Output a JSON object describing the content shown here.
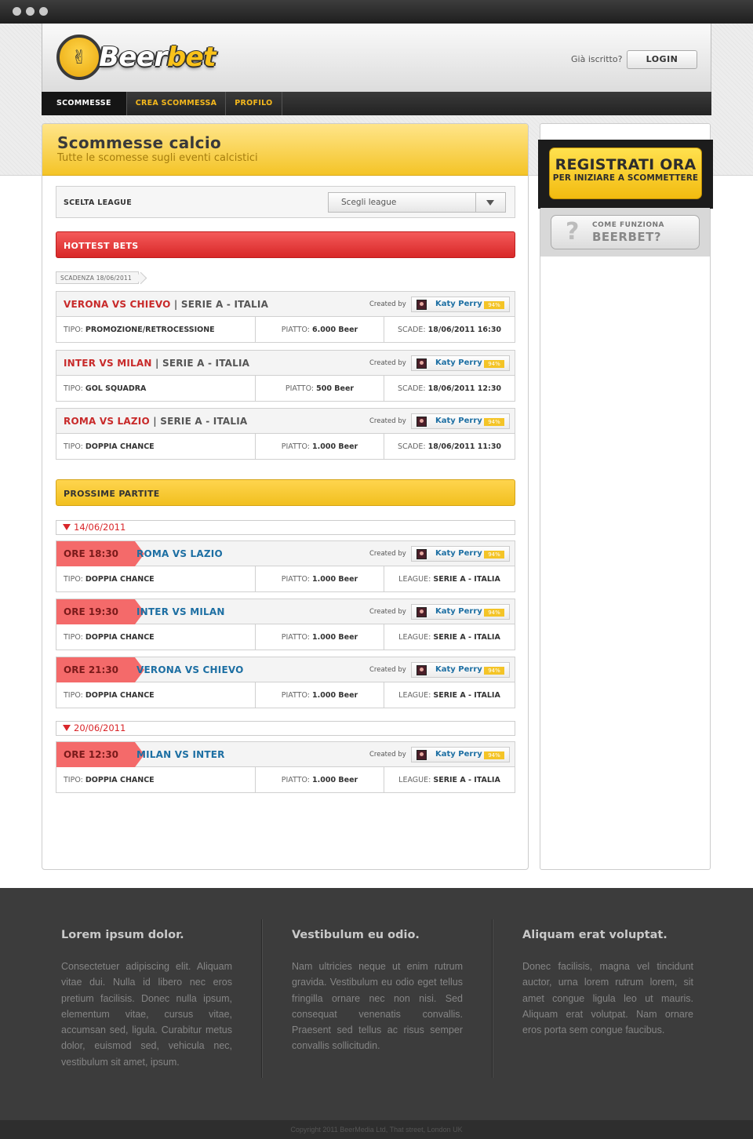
{
  "brand": {
    "logo_part1": "Beer",
    "logo_part2": "bet",
    "logo_icon": "hand-icon"
  },
  "header": {
    "login_question": "Già iscritto?",
    "login_button": "LOGIN"
  },
  "nav": [
    {
      "label": "SCOMMESSE",
      "active": true
    },
    {
      "label": "CREA SCOMMESSA",
      "active": false
    },
    {
      "label": "PROFILO",
      "active": false
    }
  ],
  "page": {
    "title": "Scommesse calcio",
    "subtitle": "Tutte le scomesse sugli eventi calcistici"
  },
  "league_filter": {
    "label": "SCELTA LEAGUE",
    "select_value": "Scegli league"
  },
  "hottest": {
    "title": "HOTTEST BETS",
    "deadline": "SCADENZA 18/06/2011",
    "bets": [
      {
        "match": "VERONA VS CHIEVO",
        "league": "SERIE A - ITALIA",
        "created_by": "Created by",
        "user": "Katy Perry",
        "pct": "94%",
        "tipo_label": "TIPO:",
        "tipo": "PROMOZIONE/RETROCESSIONE",
        "piatto_label": "PIATTO:",
        "piatto": "6.000 Beer",
        "scade_label": "SCADE:",
        "scade": "18/06/2011 16:30"
      },
      {
        "match": "INTER VS MILAN",
        "league": "SERIE A - ITALIA",
        "created_by": "Created by",
        "user": "Katy Perry",
        "pct": "94%",
        "tipo_label": "TIPO:",
        "tipo": "GOL SQUADRA",
        "piatto_label": "PIATTO:",
        "piatto": "500 Beer",
        "scade_label": "SCADE:",
        "scade": "18/06/2011 12:30"
      },
      {
        "match": "ROMA VS LAZIO",
        "league": "SERIE A - ITALIA",
        "created_by": "Created by",
        "user": "Katy Perry",
        "pct": "94%",
        "tipo_label": "TIPO:",
        "tipo": "DOPPIA CHANCE",
        "piatto_label": "PIATTO:",
        "piatto": "1.000 Beer",
        "scade_label": "SCADE:",
        "scade": "18/06/2011 11:30"
      }
    ]
  },
  "upcoming": {
    "title": "PROSSIME PARTITE",
    "groups": [
      {
        "date": "14/06/2011",
        "matches": [
          {
            "time": "ORE 18:30",
            "match": "ROMA VS LAZIO",
            "created_by": "Created by",
            "user": "Katy Perry",
            "pct": "94%",
            "tipo_label": "TIPO:",
            "tipo": "DOPPIA CHANCE",
            "piatto_label": "PIATTO:",
            "piatto": "1.000 Beer",
            "league_label": "LEAGUE:",
            "league": "SERIE A - ITALIA"
          },
          {
            "time": "ORE 19:30",
            "match": "INTER VS MILAN",
            "created_by": "Created by",
            "user": "Katy Perry",
            "pct": "94%",
            "tipo_label": "TIPO:",
            "tipo": "DOPPIA CHANCE",
            "piatto_label": "PIATTO:",
            "piatto": "1.000 Beer",
            "league_label": "LEAGUE:",
            "league": "SERIE A - ITALIA"
          },
          {
            "time": "ORE 21:30",
            "match": "VERONA VS CHIEVO",
            "created_by": "Created by",
            "user": "Katy Perry",
            "pct": "94%",
            "tipo_label": "TIPO:",
            "tipo": "DOPPIA CHANCE",
            "piatto_label": "PIATTO:",
            "piatto": "1.000 Beer",
            "league_label": "LEAGUE:",
            "league": "SERIE A - ITALIA"
          }
        ]
      },
      {
        "date": "20/06/2011",
        "matches": [
          {
            "time": "ORE 12:30",
            "match": "MILAN VS INTER",
            "created_by": "Created by",
            "user": "Katy Perry",
            "pct": "94%",
            "tipo_label": "TIPO:",
            "tipo": "DOPPIA CHANCE",
            "piatto_label": "PIATTO:",
            "piatto": "1.000 Beer",
            "league_label": "LEAGUE:",
            "league": "SERIE A - ITALIA"
          }
        ]
      }
    ]
  },
  "sidebar": {
    "register_l1": "REGISTRATI ORA",
    "register_l2": "PER INIZIARE A SCOMMETTERE",
    "how_l1": "COME FUNZIONA",
    "how_l2": "BEERBET?",
    "how_icon": "question-icon"
  },
  "footer": {
    "columns": [
      {
        "title": "Lorem ipsum dolor.",
        "text": "Consectetuer adipiscing elit. Aliquam vitae dui. Nulla id libero nec eros pretium facilisis. Donec nulla ipsum, elementum vitae, cursus vitae, accumsan sed, ligula. Curabitur metus dolor, euismod sed, vehicula nec, vestibulum sit amet, ipsum."
      },
      {
        "title": "Vestibulum eu odio.",
        "text": "Nam ultricies neque ut enim rutrum gravida. Vestibulum eu odio eget tellus fringilla ornare nec non nisi. Sed consequat venenatis convallis. Praesent sed tellus ac risus semper convallis sollicitudin."
      },
      {
        "title": "Aliquam erat voluptat.",
        "text": "Donec facilisis, magna vel tincidunt auctor, urna lorem rutrum lorem, sit amet congue ligula leo ut mauris. Aliquam erat volutpat. Nam ornare eros porta sem congue faucibus."
      }
    ],
    "copyright": "Copyright 2011 BeerMedia Ltd, That street, London UK"
  },
  "colors": {
    "accent_yellow": "#f4c427",
    "accent_red": "#d82828",
    "link_blue": "#1d6fa3",
    "footer_bg": "#3c3c3c"
  }
}
